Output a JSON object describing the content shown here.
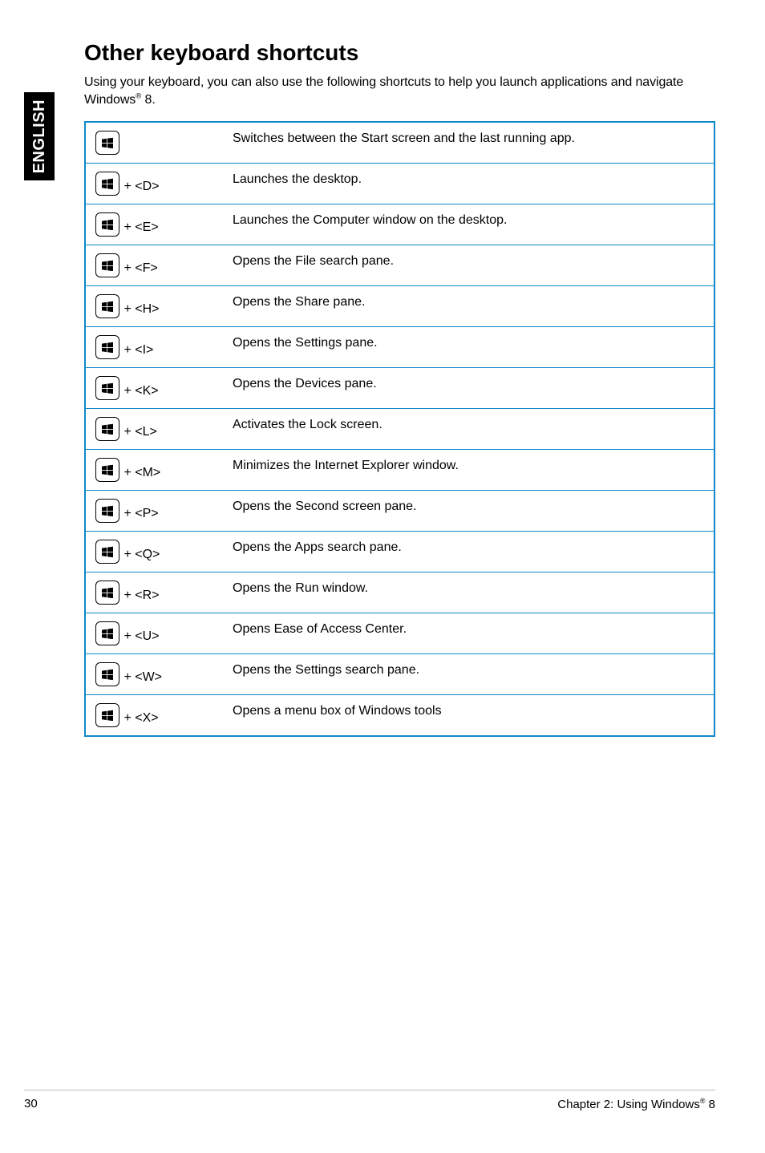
{
  "side_tab": "ENGLISH",
  "title": "Other keyboard shortcuts",
  "intro_before_sup": "Using your keyboard, you can also use the following shortcuts to help you launch applications and navigate Windows",
  "intro_sup": "®",
  "intro_after_sup": " 8.",
  "rows": [
    {
      "combo": "",
      "desc": "Switches between the Start screen and the last running app."
    },
    {
      "combo": " + <D>",
      "desc": "Launches the desktop."
    },
    {
      "combo": " + <E>",
      "desc": "Launches the Computer window on the desktop."
    },
    {
      "combo": " + <F>",
      "desc": "Opens the File search pane."
    },
    {
      "combo": " + <H>",
      "desc": "Opens the Share pane."
    },
    {
      "combo": " + <I>",
      "desc": "Opens the Settings pane."
    },
    {
      "combo": " + <K>",
      "desc": "Opens the Devices pane."
    },
    {
      "combo": " + <L>",
      "desc": "Activates the Lock screen."
    },
    {
      "combo": " + <M>",
      "desc": "Minimizes the Internet Explorer window."
    },
    {
      "combo": " + <P>",
      "desc": "Opens the Second screen pane."
    },
    {
      "combo": " + <Q>",
      "desc": "Opens the Apps search pane."
    },
    {
      "combo": " + <R>",
      "desc": "Opens the Run window."
    },
    {
      "combo": " + <U>",
      "desc": "Opens Ease of Access Center."
    },
    {
      "combo": " + <W>",
      "desc": "Opens the Settings search pane."
    },
    {
      "combo": " + <X>",
      "desc": "Opens a menu box of Windows tools"
    }
  ],
  "row_heights": [
    "med",
    "med",
    "tall",
    "med",
    "",
    "med",
    "med",
    "med",
    "",
    "med",
    "tall",
    "med",
    "med",
    "med",
    "med"
  ],
  "footer": {
    "page_number": "30",
    "chapter_before_sup": "Chapter 2: Using Windows",
    "chapter_sup": "®",
    "chapter_after_sup": " 8"
  }
}
